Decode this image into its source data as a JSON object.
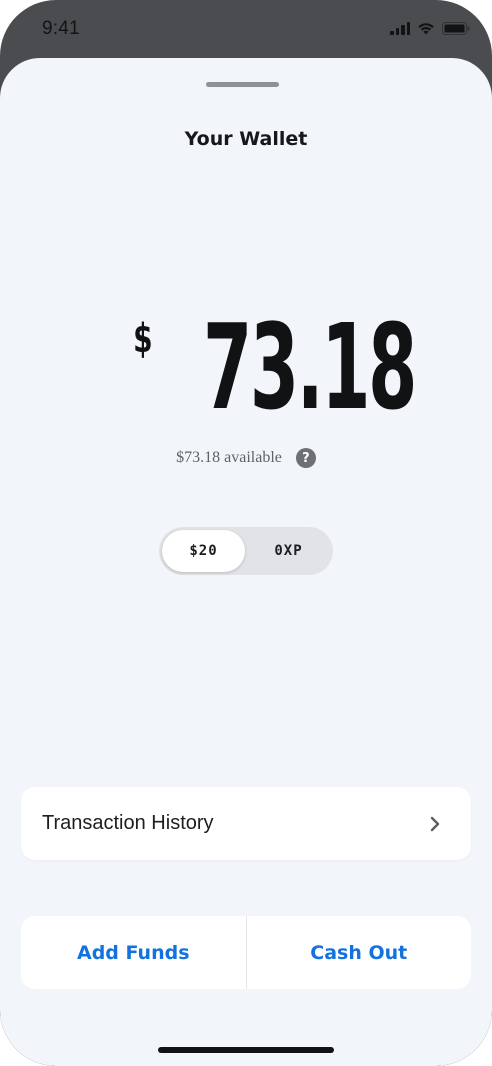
{
  "status_bar": {
    "time": "9:41",
    "icons": [
      "signal-icon",
      "wifi-icon",
      "battery-icon"
    ]
  },
  "wallet": {
    "title": "Your Wallet",
    "balance_currency": "$",
    "balance_amount": "73.18",
    "available_text": "$73.18 available",
    "help_icon": "?",
    "toggle": {
      "options": [
        "$20",
        "0XP"
      ],
      "selected": "$20"
    }
  },
  "history": {
    "label": "Transaction History"
  },
  "actions": {
    "add_funds": "Add Funds",
    "cash_out": "Cash Out"
  },
  "colors": {
    "accent": "#1472de",
    "sheet_background": "#f2f5fa",
    "frame": "#4a4c50"
  }
}
